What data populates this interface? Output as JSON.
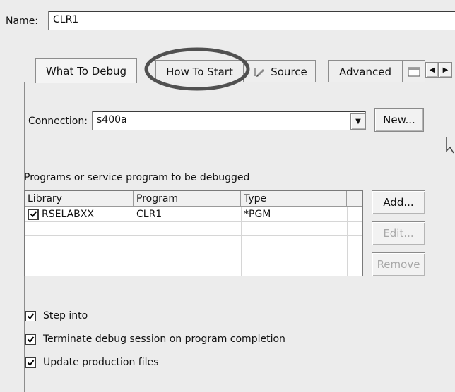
{
  "name_field": {
    "label": "Name:",
    "value": "CLR1"
  },
  "tabs": [
    {
      "label": "What To Debug",
      "active": true
    },
    {
      "label": "How To Start",
      "active": false,
      "highlighted": true
    },
    {
      "label": "Source",
      "active": false
    },
    {
      "label": "Advanced",
      "active": false
    }
  ],
  "connection": {
    "label": "Connection:",
    "value": "s400a",
    "new_button": "New..."
  },
  "programs": {
    "heading": "Programs or service program to be debugged",
    "columns": [
      "Library",
      "Program",
      "Type"
    ],
    "rows": [
      {
        "library": "RSELABXX",
        "program": "CLR1",
        "type": "*PGM",
        "checked": true
      }
    ],
    "buttons": {
      "add": "Add...",
      "edit": "Edit...",
      "remove": "Remove"
    }
  },
  "options": [
    {
      "label": "Step into",
      "checked": true
    },
    {
      "label": "Terminate debug session on program completion",
      "checked": true
    },
    {
      "label": "Update production files",
      "checked": true
    }
  ],
  "colors": {
    "background": "#ececec",
    "highlight_circle": "#555555"
  }
}
